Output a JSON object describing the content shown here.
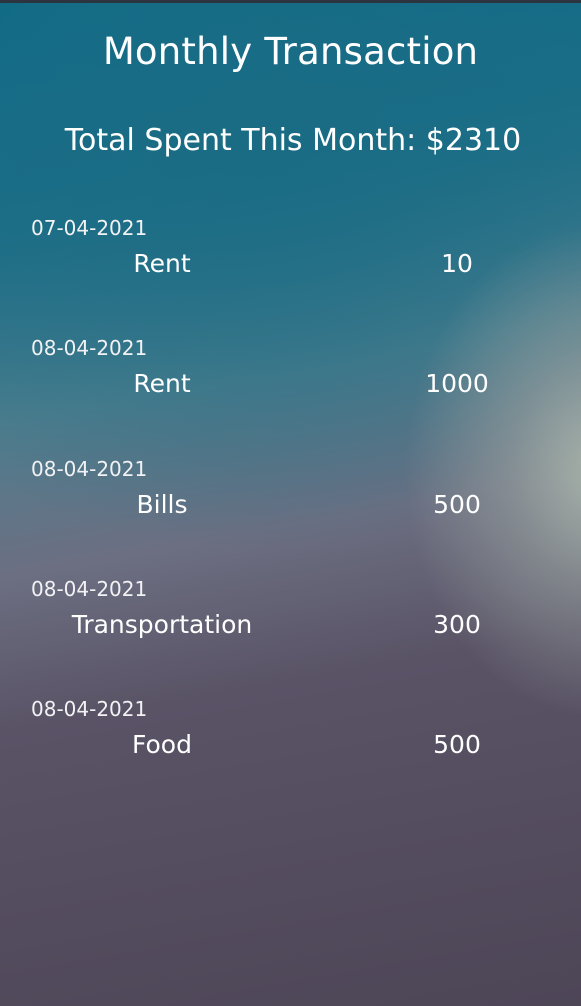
{
  "header": {
    "title": "Monthly Transaction",
    "total_spent": "Total Spent This Month: $2310"
  },
  "transactions": [
    {
      "date": "07-04-2021",
      "category": "Rent",
      "amount": "10"
    },
    {
      "date": "08-04-2021",
      "category": "Rent",
      "amount": "1000"
    },
    {
      "date": "08-04-2021",
      "category": "Bills",
      "amount": "500"
    },
    {
      "date": "08-04-2021",
      "category": "Transportation",
      "amount": "300"
    },
    {
      "date": "08-04-2021",
      "category": "Food",
      "amount": "500"
    }
  ]
}
